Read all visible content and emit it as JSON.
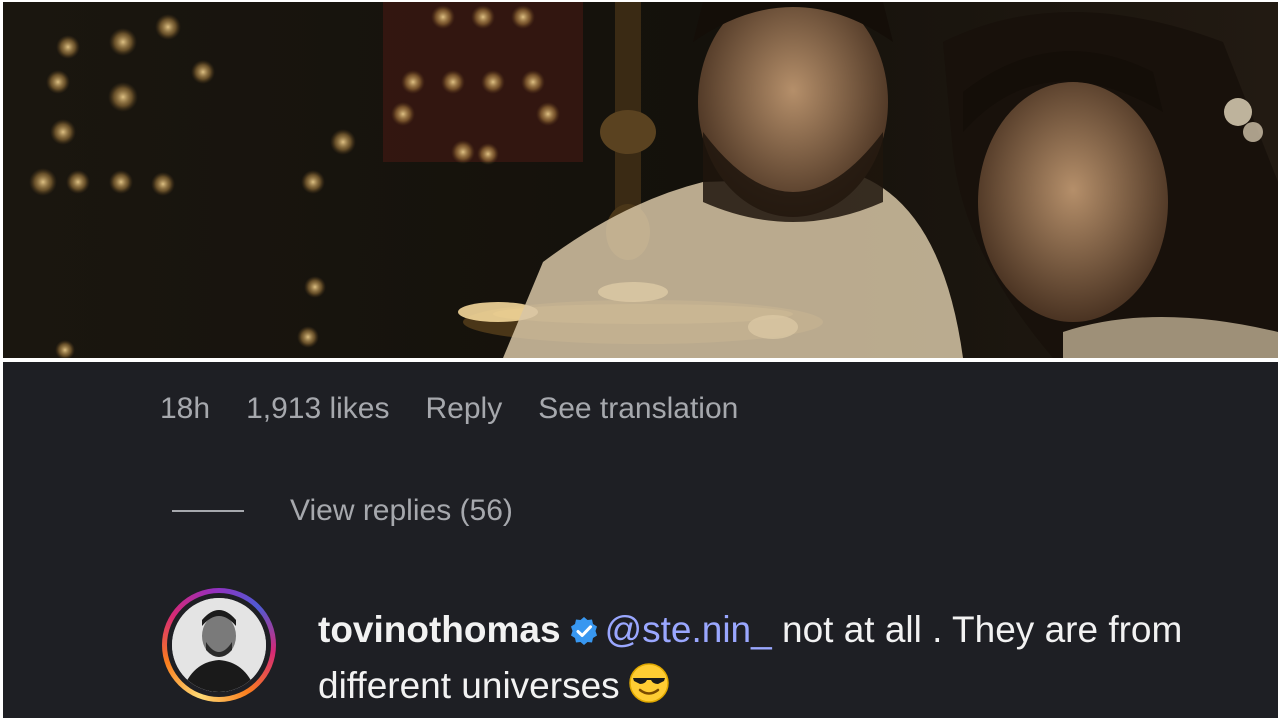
{
  "still": {
    "description_icon": "film-still-image"
  },
  "comment_meta": {
    "time": "18h",
    "likes": "1,913 likes",
    "reply": "Reply",
    "see_translation": "See translation"
  },
  "replies": {
    "label": "View replies (56)"
  },
  "reply_comment": {
    "username": "tovinothomas",
    "verified_icon": "verified-badge-icon",
    "mention": "@ste.nin_",
    "text_line1": " not at all . They are from",
    "text_line2": "different universes",
    "emoji": "sunglasses-emoji"
  },
  "colors": {
    "panel_bg": "#1e1f24",
    "meta_text": "#a6a8ad",
    "mention": "#9aa7ff",
    "verified": "#3897f0"
  }
}
